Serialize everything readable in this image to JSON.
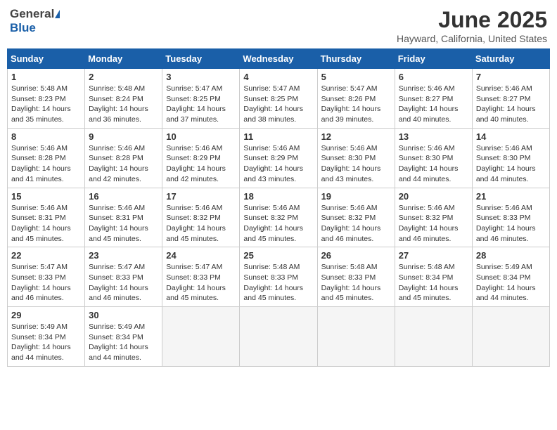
{
  "header": {
    "logo_general": "General",
    "logo_blue": "Blue",
    "title": "June 2025",
    "location": "Hayward, California, United States"
  },
  "weekdays": [
    "Sunday",
    "Monday",
    "Tuesday",
    "Wednesday",
    "Thursday",
    "Friday",
    "Saturday"
  ],
  "days": [
    {
      "num": "",
      "info": ""
    },
    {
      "num": "",
      "info": ""
    },
    {
      "num": "",
      "info": ""
    },
    {
      "num": "",
      "info": ""
    },
    {
      "num": "",
      "info": ""
    },
    {
      "num": "",
      "info": ""
    },
    {
      "num": "1",
      "info": "Sunrise: 5:48 AM\nSunset: 8:23 PM\nDaylight: 14 hours\nand 35 minutes."
    },
    {
      "num": "2",
      "info": "Sunrise: 5:48 AM\nSunset: 8:24 PM\nDaylight: 14 hours\nand 36 minutes."
    },
    {
      "num": "3",
      "info": "Sunrise: 5:47 AM\nSunset: 8:25 PM\nDaylight: 14 hours\nand 37 minutes."
    },
    {
      "num": "4",
      "info": "Sunrise: 5:47 AM\nSunset: 8:25 PM\nDaylight: 14 hours\nand 38 minutes."
    },
    {
      "num": "5",
      "info": "Sunrise: 5:47 AM\nSunset: 8:26 PM\nDaylight: 14 hours\nand 39 minutes."
    },
    {
      "num": "6",
      "info": "Sunrise: 5:46 AM\nSunset: 8:27 PM\nDaylight: 14 hours\nand 40 minutes."
    },
    {
      "num": "7",
      "info": "Sunrise: 5:46 AM\nSunset: 8:27 PM\nDaylight: 14 hours\nand 40 minutes."
    },
    {
      "num": "8",
      "info": "Sunrise: 5:46 AM\nSunset: 8:28 PM\nDaylight: 14 hours\nand 41 minutes."
    },
    {
      "num": "9",
      "info": "Sunrise: 5:46 AM\nSunset: 8:28 PM\nDaylight: 14 hours\nand 42 minutes."
    },
    {
      "num": "10",
      "info": "Sunrise: 5:46 AM\nSunset: 8:29 PM\nDaylight: 14 hours\nand 42 minutes."
    },
    {
      "num": "11",
      "info": "Sunrise: 5:46 AM\nSunset: 8:29 PM\nDaylight: 14 hours\nand 43 minutes."
    },
    {
      "num": "12",
      "info": "Sunrise: 5:46 AM\nSunset: 8:30 PM\nDaylight: 14 hours\nand 43 minutes."
    },
    {
      "num": "13",
      "info": "Sunrise: 5:46 AM\nSunset: 8:30 PM\nDaylight: 14 hours\nand 44 minutes."
    },
    {
      "num": "14",
      "info": "Sunrise: 5:46 AM\nSunset: 8:30 PM\nDaylight: 14 hours\nand 44 minutes."
    },
    {
      "num": "15",
      "info": "Sunrise: 5:46 AM\nSunset: 8:31 PM\nDaylight: 14 hours\nand 45 minutes."
    },
    {
      "num": "16",
      "info": "Sunrise: 5:46 AM\nSunset: 8:31 PM\nDaylight: 14 hours\nand 45 minutes."
    },
    {
      "num": "17",
      "info": "Sunrise: 5:46 AM\nSunset: 8:32 PM\nDaylight: 14 hours\nand 45 minutes."
    },
    {
      "num": "18",
      "info": "Sunrise: 5:46 AM\nSunset: 8:32 PM\nDaylight: 14 hours\nand 45 minutes."
    },
    {
      "num": "19",
      "info": "Sunrise: 5:46 AM\nSunset: 8:32 PM\nDaylight: 14 hours\nand 46 minutes."
    },
    {
      "num": "20",
      "info": "Sunrise: 5:46 AM\nSunset: 8:32 PM\nDaylight: 14 hours\nand 46 minutes."
    },
    {
      "num": "21",
      "info": "Sunrise: 5:46 AM\nSunset: 8:33 PM\nDaylight: 14 hours\nand 46 minutes."
    },
    {
      "num": "22",
      "info": "Sunrise: 5:47 AM\nSunset: 8:33 PM\nDaylight: 14 hours\nand 46 minutes."
    },
    {
      "num": "23",
      "info": "Sunrise: 5:47 AM\nSunset: 8:33 PM\nDaylight: 14 hours\nand 46 minutes."
    },
    {
      "num": "24",
      "info": "Sunrise: 5:47 AM\nSunset: 8:33 PM\nDaylight: 14 hours\nand 45 minutes."
    },
    {
      "num": "25",
      "info": "Sunrise: 5:48 AM\nSunset: 8:33 PM\nDaylight: 14 hours\nand 45 minutes."
    },
    {
      "num": "26",
      "info": "Sunrise: 5:48 AM\nSunset: 8:33 PM\nDaylight: 14 hours\nand 45 minutes."
    },
    {
      "num": "27",
      "info": "Sunrise: 5:48 AM\nSunset: 8:34 PM\nDaylight: 14 hours\nand 45 minutes."
    },
    {
      "num": "28",
      "info": "Sunrise: 5:49 AM\nSunset: 8:34 PM\nDaylight: 14 hours\nand 44 minutes."
    },
    {
      "num": "29",
      "info": "Sunrise: 5:49 AM\nSunset: 8:34 PM\nDaylight: 14 hours\nand 44 minutes."
    },
    {
      "num": "30",
      "info": "Sunrise: 5:49 AM\nSunset: 8:34 PM\nDaylight: 14 hours\nand 44 minutes."
    },
    {
      "num": "",
      "info": ""
    },
    {
      "num": "",
      "info": ""
    },
    {
      "num": "",
      "info": ""
    },
    {
      "num": "",
      "info": ""
    },
    {
      "num": "",
      "info": ""
    }
  ]
}
